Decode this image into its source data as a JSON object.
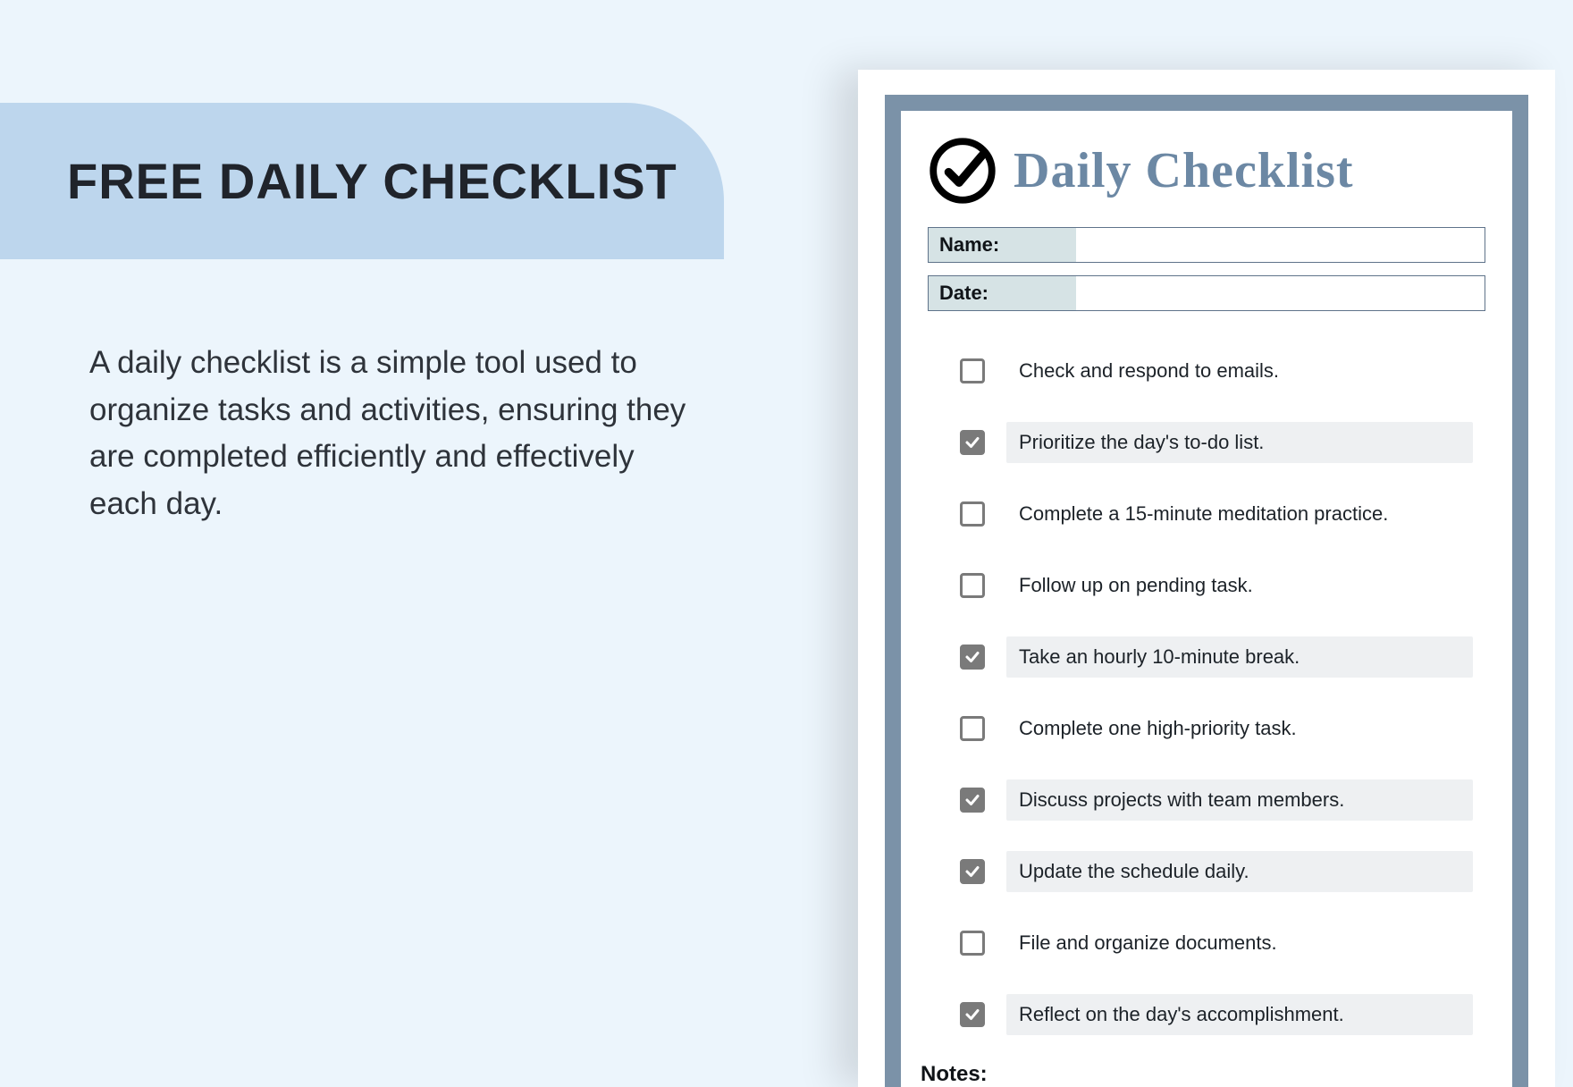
{
  "left": {
    "title": "FREE DAILY CHECKLIST",
    "description": "A daily checklist is a simple tool used to organize tasks and activities, ensuring they are completed efficiently and effectively each day."
  },
  "doc": {
    "title": "Daily Checklist",
    "fields": {
      "name_label": "Name:",
      "name_value": "",
      "date_label": "Date:",
      "date_value": ""
    },
    "items": [
      {
        "label": "Check and respond to emails.",
        "checked": false,
        "shaded": false
      },
      {
        "label": "Prioritize the day's to-do list.",
        "checked": true,
        "shaded": true
      },
      {
        "label": "Complete a 15-minute meditation practice.",
        "checked": false,
        "shaded": false
      },
      {
        "label": "Follow up on pending task.",
        "checked": false,
        "shaded": false
      },
      {
        "label": "Take an hourly 10-minute break.",
        "checked": true,
        "shaded": true
      },
      {
        "label": "Complete one high-priority task.",
        "checked": false,
        "shaded": false
      },
      {
        "label": "Discuss projects with team members.",
        "checked": true,
        "shaded": true
      },
      {
        "label": "Update the schedule daily.",
        "checked": true,
        "shaded": true
      },
      {
        "label": "File and organize documents.",
        "checked": false,
        "shaded": false
      },
      {
        "label": "Reflect on the day's accomplishment.",
        "checked": true,
        "shaded": true
      }
    ],
    "notes_label": "Notes:"
  }
}
